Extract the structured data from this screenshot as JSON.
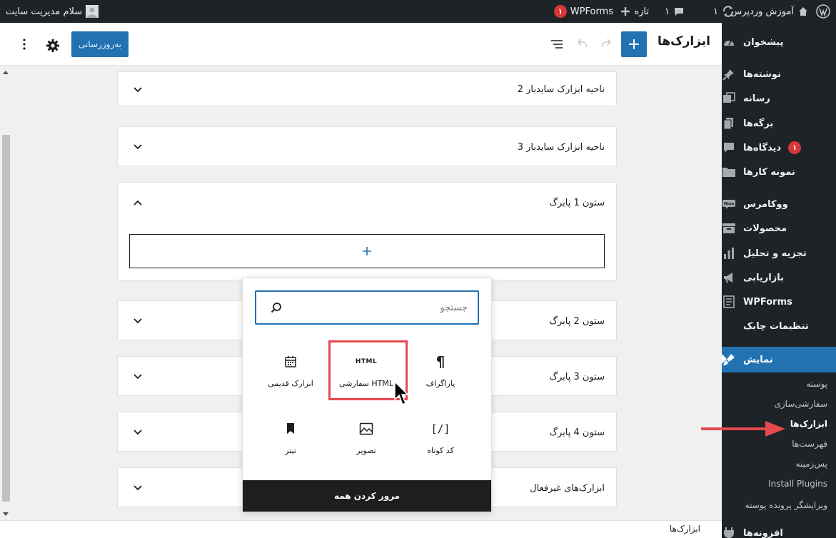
{
  "admin_bar": {
    "site_name": "آموزش وردپرس",
    "updates_count": "۱",
    "comments_count": "۱",
    "new_label": "تازه",
    "wpforms_label": "WPForms",
    "wpforms_badge": "۱",
    "greeting": "سلام مدیریت سایت"
  },
  "menu": {
    "items": [
      {
        "label": "پیشخوان",
        "icon": "dashboard-icon"
      },
      {
        "label": "نوشته‌ها",
        "icon": "pin-icon"
      },
      {
        "label": "رسانه",
        "icon": "media-icon"
      },
      {
        "label": "برگه‌ها",
        "icon": "pages-icon"
      },
      {
        "label": "دیدگاه‌ها",
        "icon": "comments-icon",
        "badge": "۱"
      },
      {
        "label": "نمونه کارها",
        "icon": "folder-icon"
      },
      {
        "label": "ووکامرس",
        "icon": "woo-icon"
      },
      {
        "label": "محصولات",
        "icon": "archive-icon"
      },
      {
        "label": "تجزیه و تحلیل",
        "icon": "chart-icon"
      },
      {
        "label": "بازاریابی",
        "icon": "megaphone-icon"
      },
      {
        "label": "WPForms",
        "icon": "forms-icon"
      },
      {
        "label": "تنظیمات چابک",
        "icon": ""
      },
      {
        "label": "نمایش",
        "icon": "brush-icon"
      },
      {
        "label": "افزونه‌ها",
        "icon": "plugin-icon"
      }
    ],
    "submenu": [
      "پوسته",
      "سفارشی‌سازی",
      "ابزارک‌ها",
      "فهرست‌ها",
      "پس‌زمینه",
      "Install Plugins",
      "ویرایشگر پرونده پوسته"
    ]
  },
  "editor": {
    "title": "ابزارک‌ها",
    "update_label": "به‌روزرسانی"
  },
  "panels": [
    {
      "title": "ناحیه ابزارک سایدبار 2",
      "expanded": false
    },
    {
      "title": "ناحیه ابزارک سایدبار 3",
      "expanded": false
    },
    {
      "title": "ستون 1 پابرگ",
      "expanded": true
    },
    {
      "title": "ستون 2 پابرگ",
      "expanded": false
    },
    {
      "title": "ستون 3 پابرگ",
      "expanded": false
    },
    {
      "title": "ستون 4 پابرگ",
      "expanded": false
    },
    {
      "title": "ابزارک‌های غیرفعال",
      "expanded": false
    }
  ],
  "inserter": {
    "search_placeholder": "جستجو",
    "blocks": [
      {
        "label": "پاراگراف",
        "icon": "paragraph-icon"
      },
      {
        "label": "HTML سفارشی",
        "icon": "html-icon",
        "icon_text": "HTML",
        "highlighted": true
      },
      {
        "label": "ابزارک قدیمی",
        "icon": "calendar-icon"
      },
      {
        "label": "کد کوتاه",
        "icon": "shortcode-icon",
        "icon_text": "[/]"
      },
      {
        "label": "تصویر",
        "icon": "image-icon"
      },
      {
        "label": "تیتر",
        "icon": "bookmark-icon"
      }
    ],
    "browse_all": "مرور کردن همه"
  },
  "footer": {
    "breadcrumb": "ابزارک‌ها"
  },
  "colors": {
    "accent": "#2271b1",
    "admin_dark": "#1d2327",
    "badge": "#d63638",
    "annotation": "#e5484d"
  }
}
